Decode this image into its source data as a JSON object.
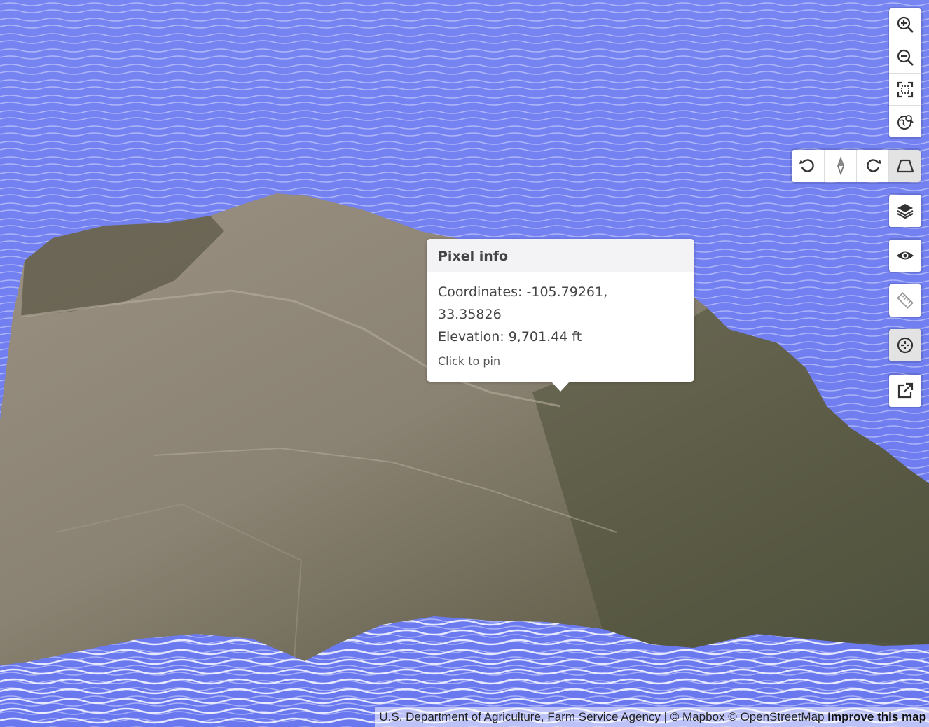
{
  "map": {
    "water_color": "#6f7df0",
    "contour_color": "#ffffff",
    "terrain_colors": [
      "#9b9184",
      "#7a7264",
      "#5f5a4a",
      "#4c5038",
      "#3e4a30"
    ]
  },
  "controls": {
    "zoom_in": "zoom-in-icon",
    "zoom_out": "zoom-out-icon",
    "fullscreen": "fullscreen-icon",
    "globe": "globe-icon",
    "rotate_left": "rotate-left-icon",
    "compass": "compass-icon",
    "rotate_right": "rotate-right-icon",
    "pitch": "pitch-icon",
    "layers": "layers-icon",
    "visibility": "eye-icon",
    "measure": "ruler-icon",
    "locate": "crosshair-icon",
    "open_external": "external-link-icon"
  },
  "popup": {
    "title": "Pixel info",
    "coordinates_label": "Coordinates: -105.79261,",
    "coordinates_cont": "33.35826",
    "elevation": "Elevation: 9,701.44 ft",
    "hint": "Click to pin"
  },
  "attribution": {
    "text": "U.S. Department of Agriculture, Farm Service Agency | © Mapbox © OpenStreetMap",
    "improve": "Improve this map"
  }
}
